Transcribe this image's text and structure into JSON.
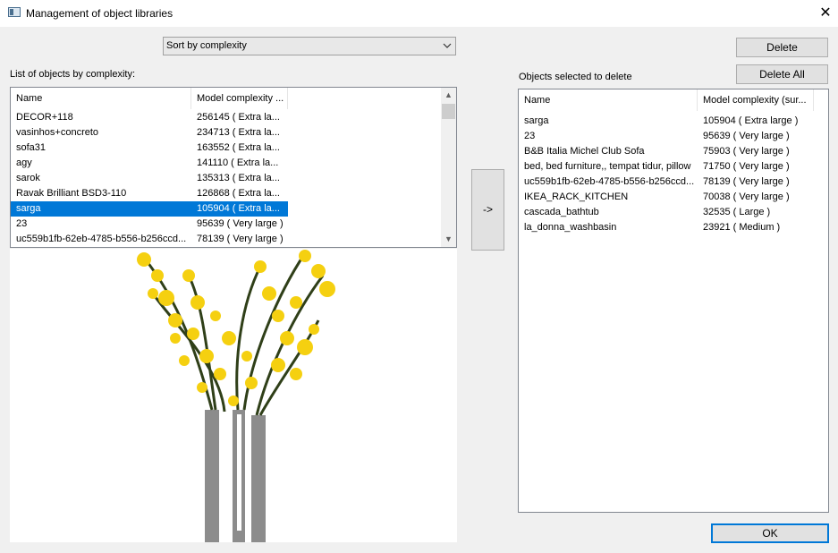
{
  "window": {
    "title": "Management of object libraries",
    "close_glyph": "✕"
  },
  "sort_combo": {
    "value": "Sort by complexity"
  },
  "left_list": {
    "label": "List of objects by complexity:",
    "columns": [
      "Name",
      "Model complexity ..."
    ],
    "rows": [
      [
        "DECOR+118",
        "256145 ( Extra la..."
      ],
      [
        "vasinhos+concreto",
        "234713 ( Extra la..."
      ],
      [
        "sofa31",
        "163552 ( Extra la..."
      ],
      [
        "agy",
        "141110 ( Extra la..."
      ],
      [
        "sarok",
        "135313 ( Extra la..."
      ],
      [
        "Ravak Brilliant BSD3-110",
        "126868 ( Extra la..."
      ],
      [
        "sarga",
        "105904 ( Extra la..."
      ],
      [
        "23",
        "95639 ( Very large )"
      ],
      [
        "uc559b1fb-62eb-4785-b556-b256ccd...",
        "78139 ( Very large )"
      ]
    ],
    "selected_index": 6
  },
  "transfer_button": {
    "label": "->"
  },
  "right_list": {
    "label": "Objects selected to delete",
    "columns": [
      "Name",
      "Model complexity (sur..."
    ],
    "rows": [
      [
        "sarga",
        "105904 ( Extra large )"
      ],
      [
        "23",
        "95639 ( Very large )"
      ],
      [
        "B&B Italia Michel Club Sofa",
        "75903 ( Very large )"
      ],
      [
        "bed, bed furniture,, tempat tidur, pillow",
        "71750 ( Very large )"
      ],
      [
        "uc559b1fb-62eb-4785-b556-b256ccd...",
        "78139 ( Very large )"
      ],
      [
        "IKEA_RACK_KITCHEN",
        "70038 ( Very large )"
      ],
      [
        "cascada_bathtub",
        "32535 ( Large )"
      ],
      [
        "la_donna_washbasin",
        "23921 ( Medium )"
      ]
    ]
  },
  "buttons": {
    "delete": "Delete",
    "delete_all": "Delete All",
    "ok": "OK"
  },
  "preview": {
    "subject": "yellow-flowers-in-vase",
    "colors": {
      "petal": "#f5d010",
      "stem": "#2f3f18",
      "vase": "#8c8c8c"
    }
  },
  "colors": {
    "selection": "#0078d7",
    "ok_border": "#0078d7"
  }
}
